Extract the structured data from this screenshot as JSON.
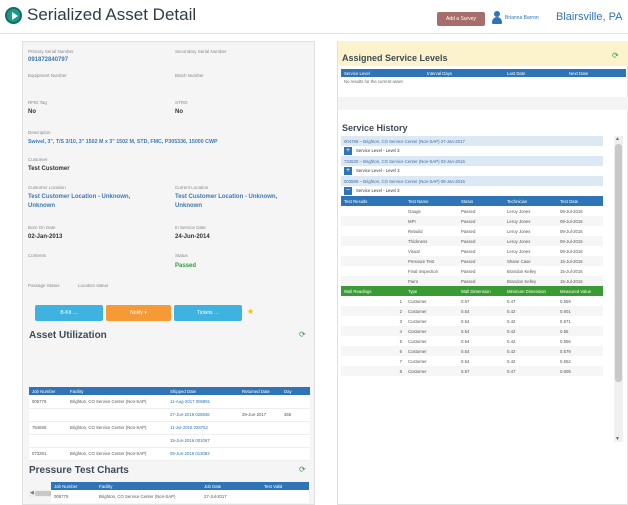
{
  "header": {
    "title": "Serialized Asset Detail",
    "action_button": "Add a Survey",
    "user_name": "Brianna Barron",
    "location": "Blairsville, PA"
  },
  "details": {
    "primary_serial": {
      "label": "Primary Serial Number",
      "value": "091872840797"
    },
    "secondary_serial": {
      "label": "Secondary Serial Number",
      "value": ""
    },
    "equipment_number": {
      "label": "Equipment Number",
      "value": ""
    },
    "batch_number": {
      "label": "Batch Number",
      "value": ""
    },
    "rfid_tag": {
      "label": "RFID Tag",
      "value": "No"
    },
    "stro": {
      "label": "STRO",
      "value": "No"
    },
    "description": {
      "label": "Description",
      "value": "Swivel, 3\", T/S 3/10, 3\" 1502 M x 3\" 1502 M, STD, FMC, P305336, 15000 CWP"
    },
    "customer": {
      "label": "Customer",
      "value": "Test Customer"
    },
    "customer_location": {
      "label": "Customer Location",
      "value_line1": "Test Customer Location - Unknown,",
      "value_line2": "Unknown"
    },
    "current_location": {
      "label": "Current Location",
      "value_line1": "Test Customer Location - Unknown,",
      "value_line2": "Unknown"
    },
    "born_on": {
      "label": "Born On Date",
      "value": "02-Jan-2013"
    },
    "in_service": {
      "label": "In Service Date",
      "value": "24-Jun-2014"
    },
    "contents": {
      "label": "Contents",
      "value": ""
    },
    "status": {
      "label": "Status",
      "value": "Passed"
    },
    "passage": {
      "label": "Passage Status",
      "value": "Location status"
    }
  },
  "actions": {
    "btn1": "B-Kit …",
    "btn2": "Notify ▾",
    "btn3": "Tickets …"
  },
  "utilization": {
    "title": "Asset Utilization",
    "columns": [
      "Job Number",
      "Facility",
      "Shipped Date",
      "Returned Date",
      "Day"
    ],
    "rows": [
      [
        "005779",
        "Brighton, CO Service Center (Non-SAP)",
        "11-Aug-2017 006891",
        "",
        ""
      ],
      [
        "",
        "",
        "27-Jun-2016 028836",
        "29-Jun-2017",
        "365"
      ],
      [
        "754655",
        "Brighton, CO Service Center (Non-SAP)",
        "11-Jul-2016 028752",
        "",
        ""
      ],
      [
        "",
        "",
        "15-Jun-2016 001067",
        "",
        ""
      ],
      [
        "073281",
        "Brighton, CO Service Center (Non-SAP)",
        "09-Jun-2016 013083",
        "",
        ""
      ]
    ]
  },
  "pressure": {
    "title": "Pressure Test Charts",
    "columns": [
      "Job Number",
      "Facility",
      "Job Date",
      "Test Valid"
    ],
    "rows": [
      [
        "005779",
        "Brighton, CO Service Center (Non-SAP)",
        "27-Jul-2017",
        ""
      ]
    ]
  },
  "service_levels": {
    "title": "Assigned Service Levels",
    "columns": [
      "Service Level",
      "Interval Days",
      "Last Date",
      "Next Date"
    ],
    "empty": "No results for the current asset"
  },
  "service_history": {
    "title": "Service History",
    "groups": [
      {
        "header": "004786 – Brighton, CO Service Center (Non-SAP) 27-Jan-2017",
        "sub": "Service Level - Level 3",
        "icon": "+"
      },
      {
        "header": "734530 – Brighton, CO Service Center (Non-SAP) 03-Jan-2016",
        "sub": "Service Level - Level 3",
        "icon": "+"
      },
      {
        "header": "003888 – Brighton, CO Service Center (Non-SAP) 08-Jan-2016",
        "sub": "Service Level - Level 3",
        "icon": "−"
      }
    ],
    "results_columns": [
      "Test Results",
      "Test Name",
      "Status",
      "Technician",
      "Test Date"
    ],
    "results": [
      [
        "",
        "Gauge",
        "Passed",
        "Leroy Jones",
        "09-Jul-2016"
      ],
      [
        "",
        "MPI",
        "Passed",
        "Leroy Jones",
        "09-Jul-2016"
      ],
      [
        "",
        "Rebuild",
        "Passed",
        "Leroy Jones",
        "09-Jul-2016"
      ],
      [
        "",
        "Thickness",
        "Passed",
        "Leroy Jones",
        "09-Jul-2016"
      ],
      [
        "",
        "Visual",
        "Passed",
        "Leroy Jones",
        "09-Jul-2016"
      ],
      [
        "",
        "Pressure Test",
        "Passed",
        "Shane Case",
        "15-Jul-2016"
      ],
      [
        "",
        "Final Inspection",
        "Passed",
        "Brandon Kelley",
        "15-Jul-2016"
      ],
      [
        "",
        "Paint",
        "Passed",
        "Brandon Kelley",
        "15-Jul-2016"
      ]
    ],
    "wall_columns": [
      "Wall Readings",
      "Type",
      "Wall Dimension",
      "Minimum Dimension",
      "Measured Value"
    ],
    "wall": [
      [
        "1",
        "Customer",
        "0.57",
        "0.47",
        "0.559"
      ],
      [
        "2",
        "Customer",
        "0.54",
        "0.42",
        "0.601"
      ],
      [
        "3",
        "Customer",
        "0.54",
        "0.42",
        "0.571"
      ],
      [
        "4",
        "Customer",
        "0.54",
        "0.42",
        "0.55"
      ],
      [
        "5",
        "Customer",
        "0.54",
        "0.42",
        "0.556"
      ],
      [
        "6",
        "Customer",
        "0.54",
        "0.42",
        "0.579"
      ],
      [
        "7",
        "Customer",
        "0.54",
        "0.42",
        "0.552"
      ],
      [
        "8",
        "Customer",
        "0.57",
        "0.47",
        "0.605"
      ]
    ]
  }
}
